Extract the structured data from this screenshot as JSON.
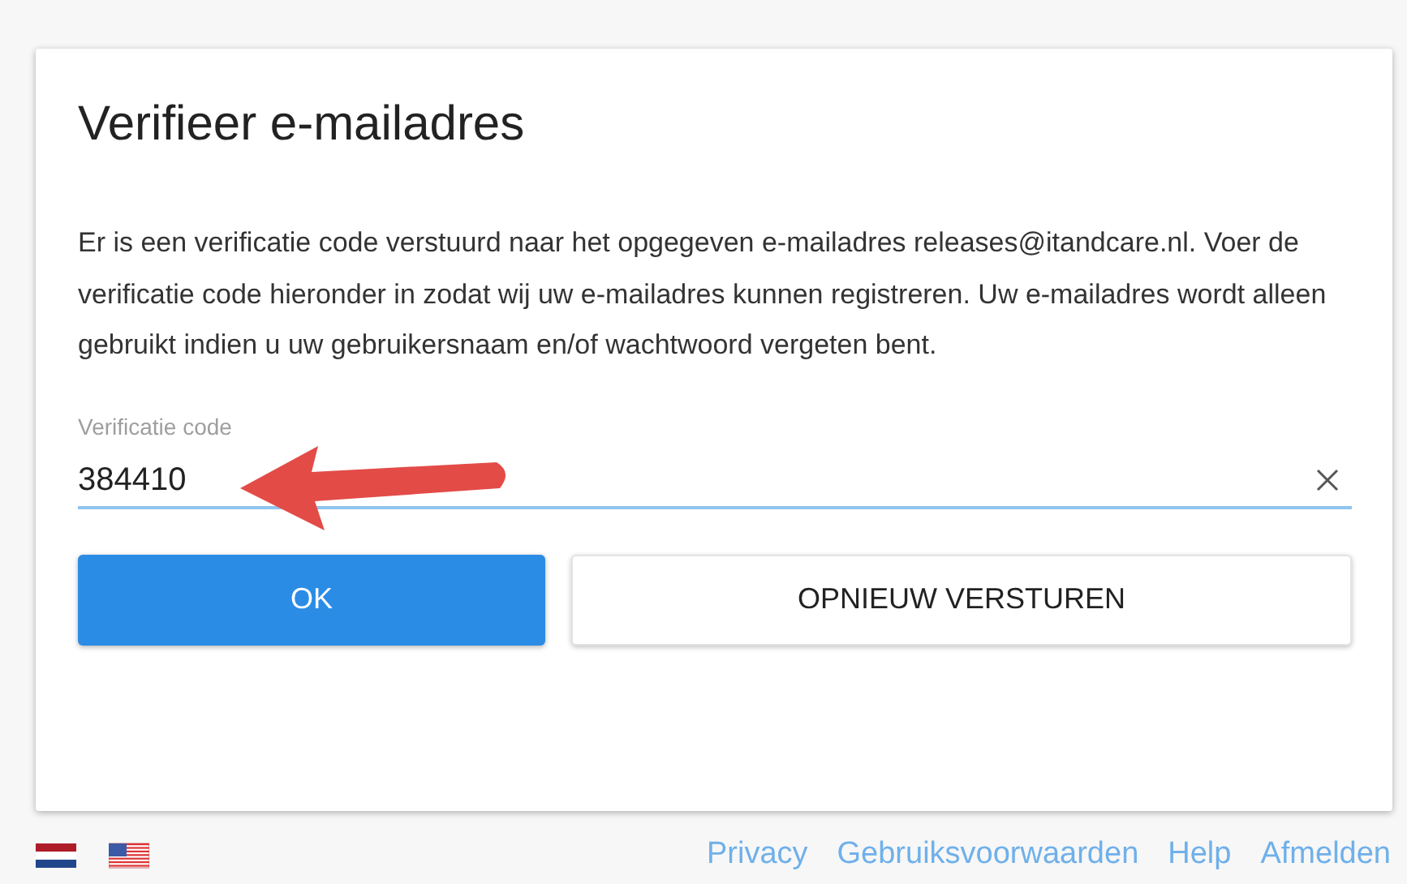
{
  "dialog": {
    "title": "Verifieer e-mailadres",
    "message": "Er is een verificatie code verstuurd naar het opgegeven e-mailadres releases@itandcare.nl. Voer de verificatie code hieronder in zodat wij uw e-mailadres kunnen registreren. Uw e-mailadres wordt alleen gebruikt indien u uw gebruikersnaam en/of wachtwoord vergeten bent.",
    "field": {
      "label": "Verificatie code",
      "value": "384410",
      "focused": true
    },
    "buttons": [
      {
        "label": "OK",
        "kind": "primary"
      },
      {
        "label": "OPNIEUW VERSTUREN",
        "kind": "secondary"
      }
    ]
  },
  "footer": {
    "languages": [
      {
        "kind": "nl"
      },
      {
        "kind": "us"
      }
    ],
    "links": [
      "Privacy",
      "Gebruiksvoorwaarden",
      "Help",
      "Afmelden"
    ]
  }
}
